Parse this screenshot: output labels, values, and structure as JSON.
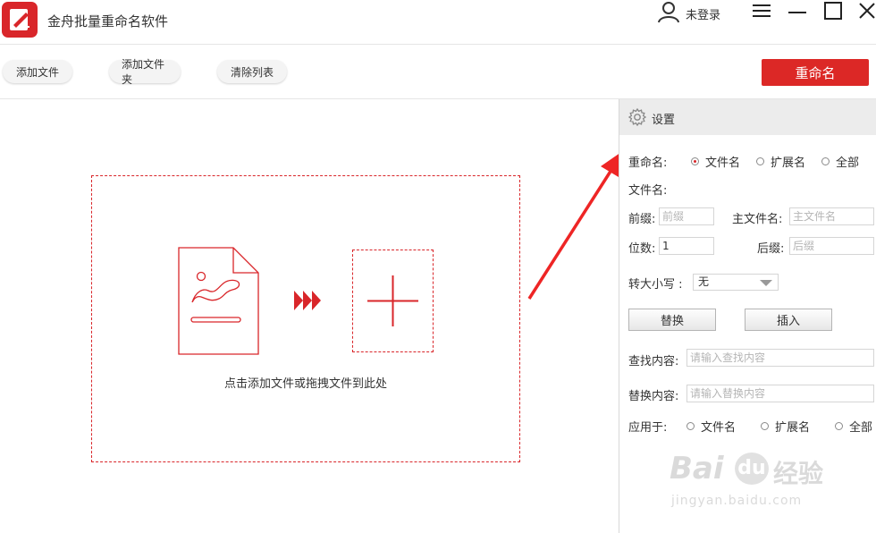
{
  "app": {
    "title": "金舟批量重命名软件",
    "user_label": "未登录",
    "accent": "#d9262a"
  },
  "window_controls": [
    "menu-icon",
    "minimize-icon",
    "maximize-icon",
    "close-icon"
  ],
  "toolbar": {
    "add_file": "添加文件",
    "add_folder": "添加文件夹",
    "clear_list": "清除列表",
    "rename": "重命名"
  },
  "drop": {
    "hint": "点击添加文件或拖拽文件到此处"
  },
  "settings": {
    "title": "设置",
    "rename_label": "重命名:",
    "rename_options": [
      "文件名",
      "扩展名",
      "全部"
    ],
    "rename_selected": "文件名",
    "filename_section": "文件名:",
    "prefix_label": "前缀:",
    "prefix_placeholder": "前缀",
    "mainname_label": "主文件名:",
    "mainname_placeholder": "主文件名",
    "digits_label": "位数:",
    "digits_value": "1",
    "suffix_label": "后缀:",
    "suffix_placeholder": "后缀",
    "case_label": "转大小写 :",
    "case_value": "无",
    "replace_button": "替换",
    "insert_button": "插入",
    "find_label": "查找内容:",
    "find_placeholder": "请输入查找内容",
    "replace_label": "替换内容:",
    "replace_placeholder": "请输入替换内容",
    "apply_label": "应用于:",
    "apply_options": [
      "文件名",
      "扩展名",
      "全部"
    ]
  },
  "watermark": {
    "brand": "Bai",
    "brand_du": "du",
    "brand_cn": "经验",
    "url": "jingyan.baidu.com"
  }
}
